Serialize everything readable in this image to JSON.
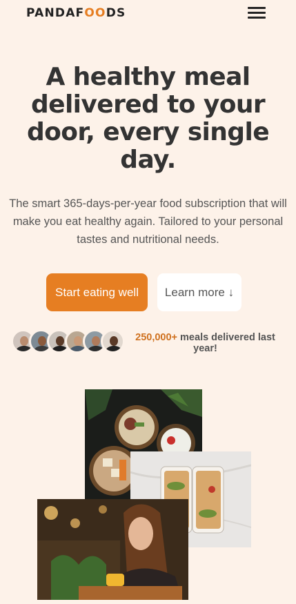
{
  "brand": {
    "logo_pre": "PANDAF",
    "logo_oo": "OO",
    "logo_post": "DS",
    "accent": "#e67e22"
  },
  "nav": {
    "menu_icon": "hamburger-icon"
  },
  "hero": {
    "headline": "A healthy meal delivered to your door, every single day.",
    "description": "The smart 365-days-per-year food subscription that will make you eat healthy again. Tailored to your personal tastes and nutritional needs.",
    "primary_button": "Start eating well",
    "secondary_button": "Learn more ↓"
  },
  "social_proof": {
    "count": "250,000+",
    "label": " meals delivered last year!"
  }
}
